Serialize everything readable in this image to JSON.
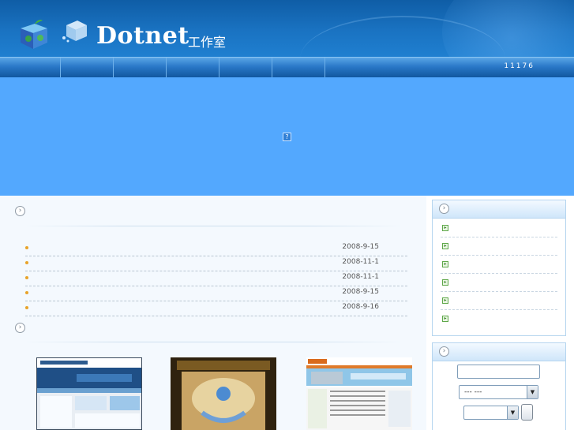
{
  "header": {
    "logo_title": "Dotnet",
    "logo_subtitle": "工作室",
    "cube_icon": "globe-cube-icon",
    "crystal_icon": "ice-cube-icon"
  },
  "nav": {
    "items": [
      "",
      "",
      "",
      "",
      "",
      ""
    ],
    "counter": "11176"
  },
  "banner": {
    "background": "#53a8fe",
    "placeholder_glyph": "?"
  },
  "news_section": {
    "icon": "chevron-right-circle-icon",
    "items": [
      {
        "title": "",
        "date": "2008-9-15"
      },
      {
        "title": "",
        "date": "2008-11-1"
      },
      {
        "title": "",
        "date": "2008-11-1"
      },
      {
        "title": "",
        "date": "2008-9-15"
      },
      {
        "title": "",
        "date": "2008-9-16"
      }
    ]
  },
  "showcase_section": {
    "icon": "chevron-right-circle-icon",
    "thumbnails": [
      "website-screenshot-1",
      "website-screenshot-2",
      "website-screenshot-3"
    ]
  },
  "sidebar": {
    "links_box": {
      "icon": "chevron-right-circle-icon",
      "items": [
        "",
        "",
        "",
        "",
        "",
        ""
      ],
      "item_icon": "green-arrow-icon"
    },
    "search_box": {
      "icon": "chevron-right-circle-icon",
      "keyword_value": "",
      "category_selected": "---  ---",
      "type_selected": "",
      "submit_label": ""
    }
  },
  "colors": {
    "header": "#1a73c2",
    "nav": "#2a78c8",
    "banner": "#53a8fe",
    "accent_bullet": "#e8a32a",
    "link_icon": "#5fa84a"
  }
}
